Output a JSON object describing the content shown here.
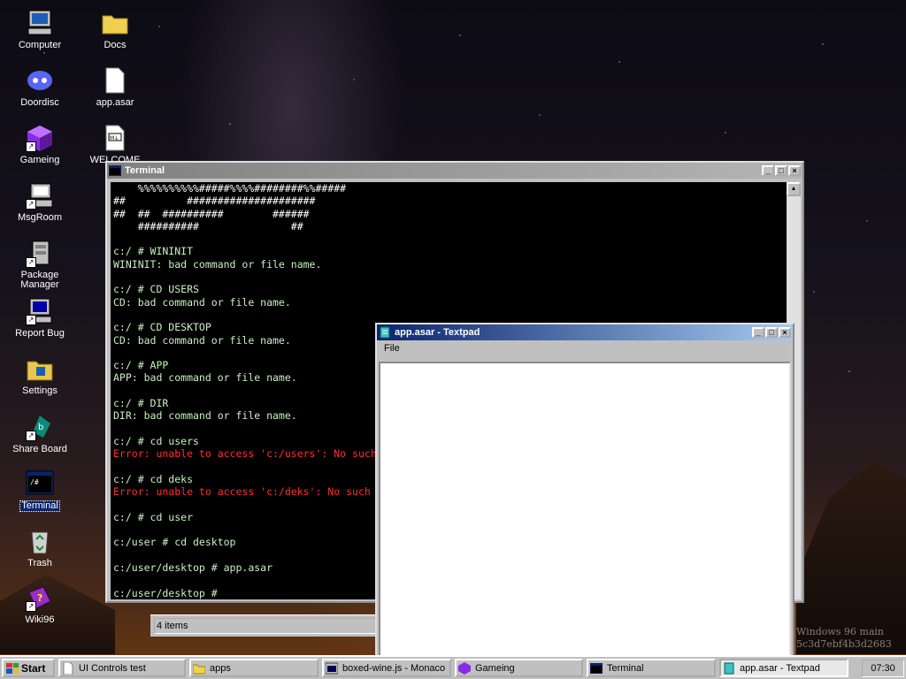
{
  "desktop": {
    "icons": [
      {
        "label": "Computer"
      },
      {
        "label": "Doordisc"
      },
      {
        "label": "Gameing"
      },
      {
        "label": "MsgRoom"
      },
      {
        "label": "Package Manager"
      },
      {
        "label": "Report Bug"
      },
      {
        "label": "Settings"
      },
      {
        "label": "Share Board"
      },
      {
        "label": "Terminal"
      },
      {
        "label": "Trash"
      },
      {
        "label": "Wiki96"
      },
      {
        "label": "Docs"
      },
      {
        "label": "app.asar"
      },
      {
        "label": "WELCOME"
      }
    ],
    "watermark_line1": "Windows 96 main",
    "watermark_line2": "5c3d7ebf4b3d2683"
  },
  "terminal": {
    "title": "Terminal",
    "lines": [
      {
        "text": "    %%%%%%%%%%#####%%%%########%%#####",
        "kind": "art"
      },
      {
        "text": "##          #####################",
        "kind": "art"
      },
      {
        "text": "##  ##  ##########        ######",
        "kind": "art"
      },
      {
        "text": "    ##########               ##",
        "kind": "art"
      },
      {
        "text": "",
        "kind": "out"
      },
      {
        "text": "c:/ # WININIT",
        "kind": "out"
      },
      {
        "text": "WININIT: bad command or file name.",
        "kind": "out"
      },
      {
        "text": "",
        "kind": "out"
      },
      {
        "text": "c:/ # CD USERS",
        "kind": "out"
      },
      {
        "text": "CD: bad command or file name.",
        "kind": "out"
      },
      {
        "text": "",
        "kind": "out"
      },
      {
        "text": "c:/ # CD DESKTOP",
        "kind": "out"
      },
      {
        "text": "CD: bad command or file name.",
        "kind": "out"
      },
      {
        "text": "",
        "kind": "out"
      },
      {
        "text": "c:/ # APP",
        "kind": "out"
      },
      {
        "text": "APP: bad command or file name.",
        "kind": "out"
      },
      {
        "text": "",
        "kind": "out"
      },
      {
        "text": "c:/ # DIR",
        "kind": "out"
      },
      {
        "text": "DIR: bad command or file name.",
        "kind": "out"
      },
      {
        "text": "",
        "kind": "out"
      },
      {
        "text": "c:/ # cd users",
        "kind": "out"
      },
      {
        "text": "Error: unable to access 'c:/users': No such",
        "kind": "err"
      },
      {
        "text": "",
        "kind": "out"
      },
      {
        "text": "c:/ # cd deks",
        "kind": "out"
      },
      {
        "text": "Error: unable to access 'c:/deks': No such",
        "kind": "err"
      },
      {
        "text": "",
        "kind": "out"
      },
      {
        "text": "c:/ # cd user",
        "kind": "out"
      },
      {
        "text": "",
        "kind": "out"
      },
      {
        "text": "c:/user # cd desktop",
        "kind": "out"
      },
      {
        "text": "",
        "kind": "out"
      },
      {
        "text": "c:/user/desktop # app.asar",
        "kind": "out"
      },
      {
        "text": "",
        "kind": "out"
      },
      {
        "text": "c:/user/desktop #",
        "kind": "out"
      }
    ]
  },
  "explorer_status": {
    "items": "4 items"
  },
  "textpad": {
    "title": "app.asar - Textpad",
    "menu": [
      "File"
    ],
    "content": ""
  },
  "taskbar": {
    "start_label": "Start",
    "buttons": [
      {
        "label": "UI Controls test",
        "icon": "document-icon"
      },
      {
        "label": "apps",
        "icon": "folder-icon"
      },
      {
        "label": "boxed-wine.js - Monaco",
        "icon": "code-icon"
      },
      {
        "label": "Gameing",
        "icon": "cube-icon"
      },
      {
        "label": "Terminal",
        "icon": "terminal-icon"
      },
      {
        "label": "app.asar - Textpad",
        "icon": "notepad-icon",
        "active": true
      }
    ],
    "clock": "07:30"
  }
}
